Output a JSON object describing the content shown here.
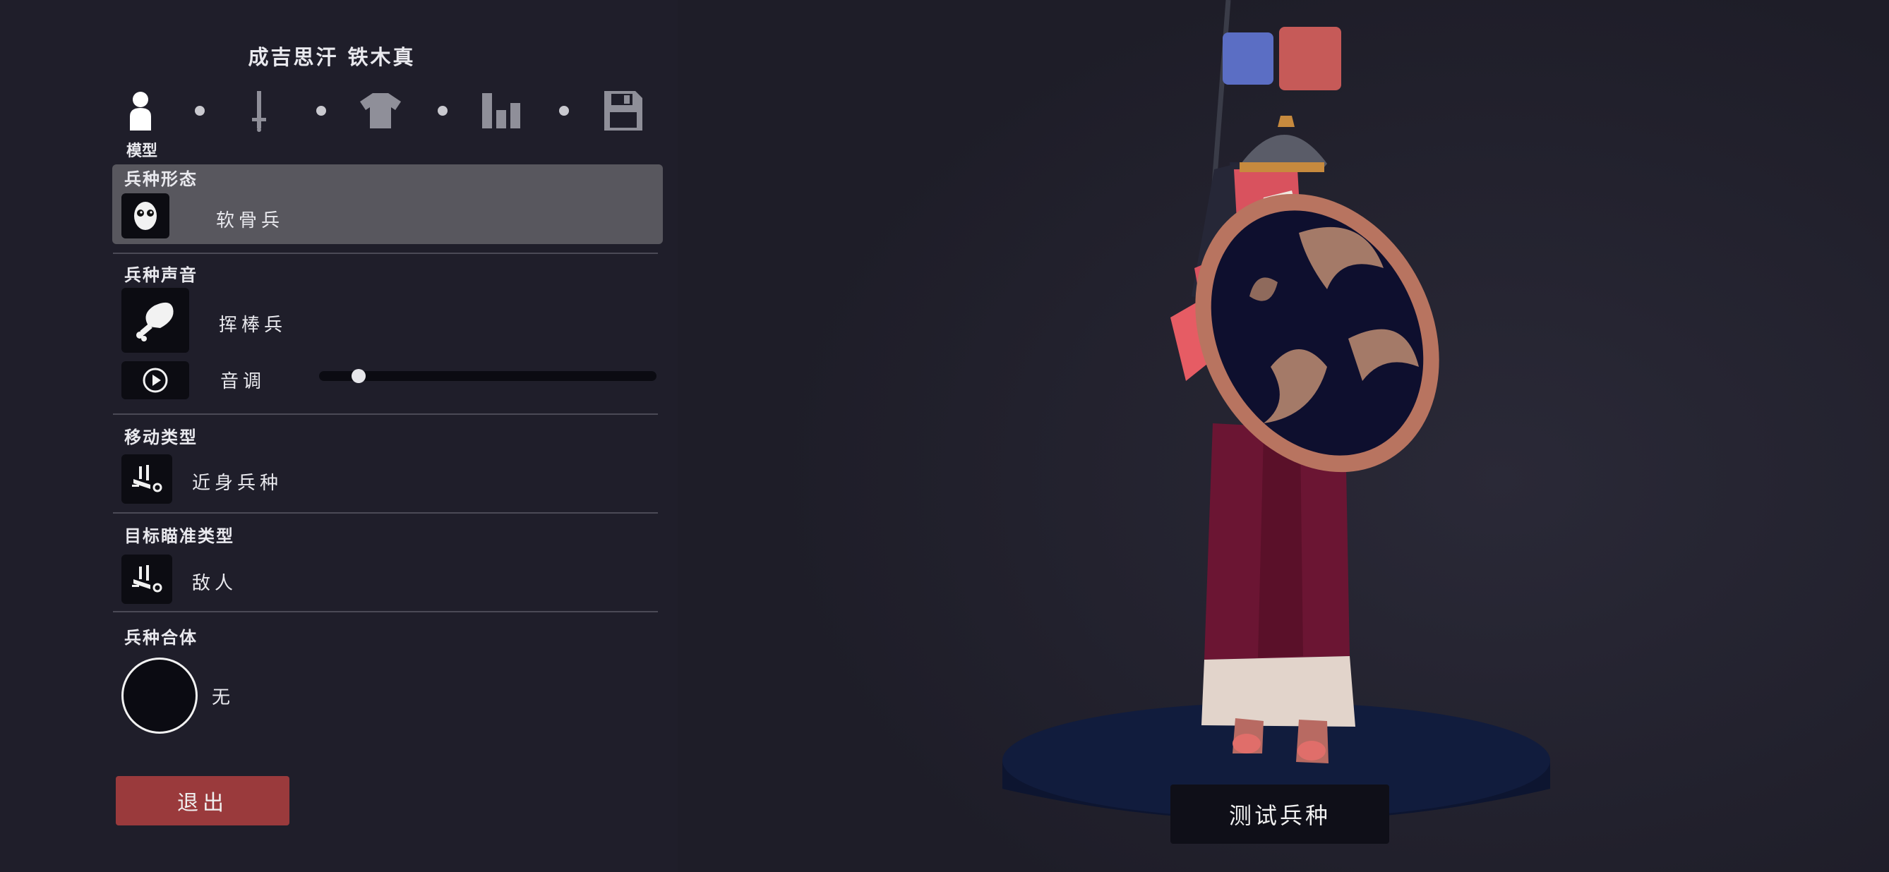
{
  "unit": {
    "name": "成吉思汗 铁木真"
  },
  "tabs": [
    {
      "icon": "person-icon",
      "label": "模型",
      "active": true
    },
    {
      "icon": "sword-icon",
      "label": "",
      "active": false
    },
    {
      "icon": "shirt-icon",
      "label": "",
      "active": false
    },
    {
      "icon": "stats-icon",
      "label": "",
      "active": false
    },
    {
      "icon": "save-icon",
      "label": "",
      "active": false
    }
  ],
  "sections": {
    "form": {
      "title": "兵种形态",
      "value": "软骨兵",
      "icon": "skull-face-icon"
    },
    "voice": {
      "title": "兵种声音",
      "value": "挥棒兵",
      "icon": "drumstick-icon",
      "pitch_label": "音调",
      "pitch_level": 0.1
    },
    "movement": {
      "title": "移动类型",
      "value": "近身兵种",
      "icon": "unit-move-icon"
    },
    "targeting": {
      "title": "目标瞄准类型",
      "value": "敌人",
      "icon": "unit-target-icon"
    },
    "combo": {
      "title": "兵种合体",
      "value": "无"
    }
  },
  "buttons": {
    "exit": "退出",
    "test": "测试兵种"
  },
  "colors": {
    "background": "#1f1e2a",
    "panel_selected": "#58575e",
    "exit_button": "#9a3a3c",
    "team_blue": "#5b6ec4",
    "team_red": "#c65a58"
  }
}
